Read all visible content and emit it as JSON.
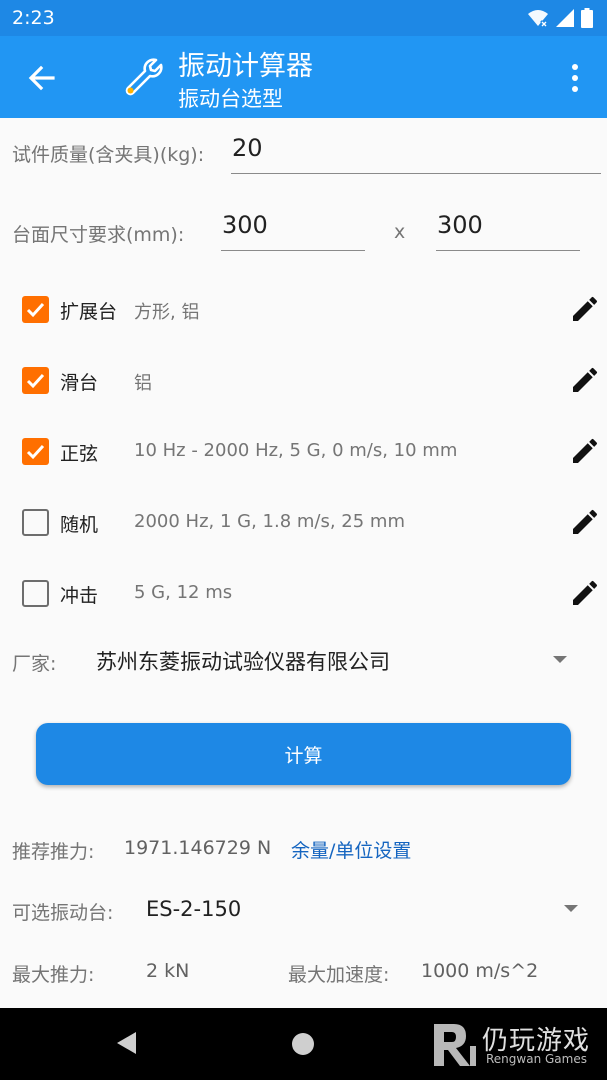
{
  "status_bar": {
    "time": "2:23"
  },
  "app_bar": {
    "title": "振动计算器",
    "subtitle": "振动台选型"
  },
  "form": {
    "mass_label": "试件质量(含夹具)(kg):",
    "mass_value": "20",
    "size_label": "台面尺寸要求(mm):",
    "size_x": "300",
    "size_sep": "x",
    "size_y": "300"
  },
  "options": [
    {
      "label": "扩展台",
      "detail": "方形, 铝",
      "checked": true
    },
    {
      "label": "滑台",
      "detail": "铝",
      "checked": true
    },
    {
      "label": "正弦",
      "detail": "10 Hz - 2000 Hz, 5 G, 0 m/s, 10 mm",
      "checked": true
    },
    {
      "label": "随机",
      "detail": "2000 Hz, 1 G, 1.8 m/s, 25 mm",
      "checked": false
    },
    {
      "label": "冲击",
      "detail": "5 G, 12 ms",
      "checked": false
    }
  ],
  "vendor": {
    "label": "厂家:",
    "value": "苏州东菱振动试验仪器有限公司"
  },
  "calc_button": "计算",
  "result": {
    "thrust_label": "推荐推力:",
    "thrust_value": "1971.146729 N",
    "margin_link": "余量/单位设置",
    "table_label": "可选振动台:",
    "table_value": "ES-2-150",
    "max_thrust_label": "最大推力:",
    "max_thrust_value": "2 kN",
    "max_acc_label": "最大加速度:",
    "max_acc_value": "1000 m/s^2"
  },
  "watermark": {
    "title": "仍玩游戏",
    "subtitle": "Rengwan Games"
  },
  "colors": {
    "primary": "#2196f3",
    "status": "#1e88e5",
    "accent": "#ff6f00"
  }
}
